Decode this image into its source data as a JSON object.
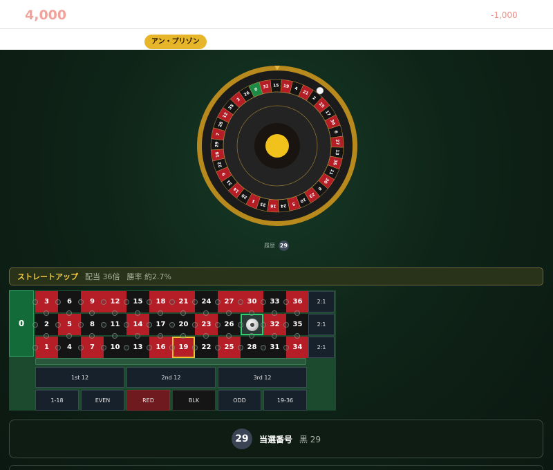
{
  "header": {
    "balance": "4,000",
    "delta": "-1,000",
    "player_tag": "アン・プリゾン"
  },
  "wheel": {
    "sequence": [
      "0",
      "32",
      "15",
      "19",
      "4",
      "21",
      "2",
      "25",
      "17",
      "34",
      "6",
      "27",
      "13",
      "36",
      "11",
      "30",
      "8",
      "23",
      "10",
      "5",
      "24",
      "16",
      "33",
      "1",
      "20",
      "14",
      "31",
      "9",
      "22",
      "18",
      "29",
      "7",
      "28",
      "12",
      "35",
      "3",
      "26"
    ],
    "ball_number": "2",
    "colors": {
      "red": "#b51d27",
      "black": "#141414",
      "green": "#1d8a45",
      "rim": "#b88a1e",
      "hub": "#f0c21b"
    }
  },
  "history": {
    "label": "履歴",
    "numbers": [
      "29"
    ]
  },
  "bet_info": {
    "name": "ストレートアップ",
    "payout": "配当 36倍",
    "odds": "勝率 約2.7%"
  },
  "board": {
    "zero": "0",
    "rows": [
      [
        "3",
        "6",
        "9",
        "12",
        "15",
        "18",
        "21",
        "24",
        "27",
        "30",
        "33",
        "36"
      ],
      [
        "2",
        "5",
        "8",
        "11",
        "14",
        "17",
        "20",
        "23",
        "26",
        "29",
        "32",
        "35"
      ],
      [
        "1",
        "4",
        "7",
        "10",
        "13",
        "16",
        "19",
        "22",
        "25",
        "28",
        "31",
        "34"
      ]
    ],
    "red_numbers": [
      "1",
      "3",
      "5",
      "7",
      "9",
      "12",
      "14",
      "16",
      "18",
      "19",
      "21",
      "23",
      "25",
      "27",
      "30",
      "32",
      "34",
      "36"
    ],
    "highlighted_number": "19",
    "selected_number": "29",
    "column_bets": [
      "2:1",
      "2:1",
      "2:1"
    ],
    "dozens": [
      "1st 12",
      "2nd 12",
      "3rd 12"
    ],
    "even_money": [
      "1-18",
      "EVEN",
      "RED",
      "BLK",
      "ODD",
      "19-36"
    ]
  },
  "result": {
    "number": "29",
    "label": "当選番号",
    "value": "黒 29"
  }
}
